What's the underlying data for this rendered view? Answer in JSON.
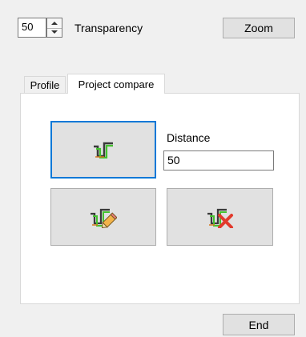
{
  "top": {
    "transparency_value": "50",
    "transparency_label": "Transparency",
    "zoom_label": "Zoom"
  },
  "tabs": [
    {
      "label": "Profile",
      "active": false
    },
    {
      "label": "Project compare",
      "active": true
    }
  ],
  "compare": {
    "distance_label": "Distance",
    "distance_value": "50",
    "icons": [
      "profile-compare-icon",
      "edit-profile-icon",
      "delete-profile-icon"
    ]
  },
  "footer": {
    "end_label": "End"
  },
  "colors": {
    "selected_border": "#0078d7",
    "button_bg": "#e1e1e1",
    "window_bg": "#f0f0f0"
  }
}
